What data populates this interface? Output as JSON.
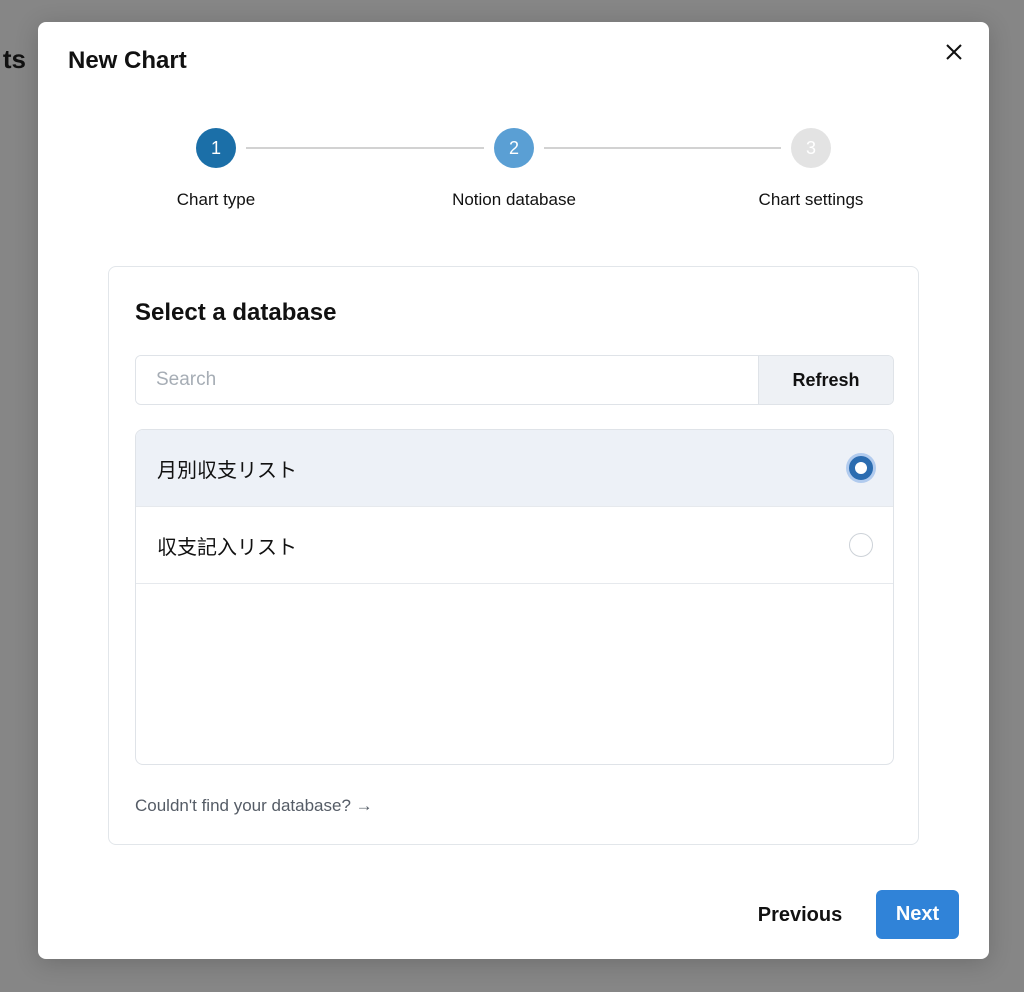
{
  "background": {
    "partial_heading": "ts"
  },
  "modal": {
    "title": "New Chart",
    "close_icon": "close-icon"
  },
  "stepper": {
    "steps": [
      {
        "number": "1",
        "label": "Chart type",
        "state": "completed",
        "color": "#1b6fa8"
      },
      {
        "number": "2",
        "label": "Notion database",
        "state": "active",
        "color": "#5a9fd4"
      },
      {
        "number": "3",
        "label": "Chart settings",
        "state": "upcoming",
        "color": "#e3e3e3"
      }
    ]
  },
  "database_picker": {
    "title": "Select a database",
    "search": {
      "placeholder": "Search",
      "value": ""
    },
    "refresh_label": "Refresh",
    "databases": [
      {
        "name": "月別収支リスト",
        "selected": true
      },
      {
        "name": "収支記入リスト",
        "selected": false
      }
    ],
    "help_link": "Couldn't find your database? →"
  },
  "footer": {
    "previous_label": "Previous",
    "next_label": "Next"
  },
  "colors": {
    "accent": "#3083d8",
    "selected_row": "#edf1f7",
    "overlay": "#868686"
  }
}
